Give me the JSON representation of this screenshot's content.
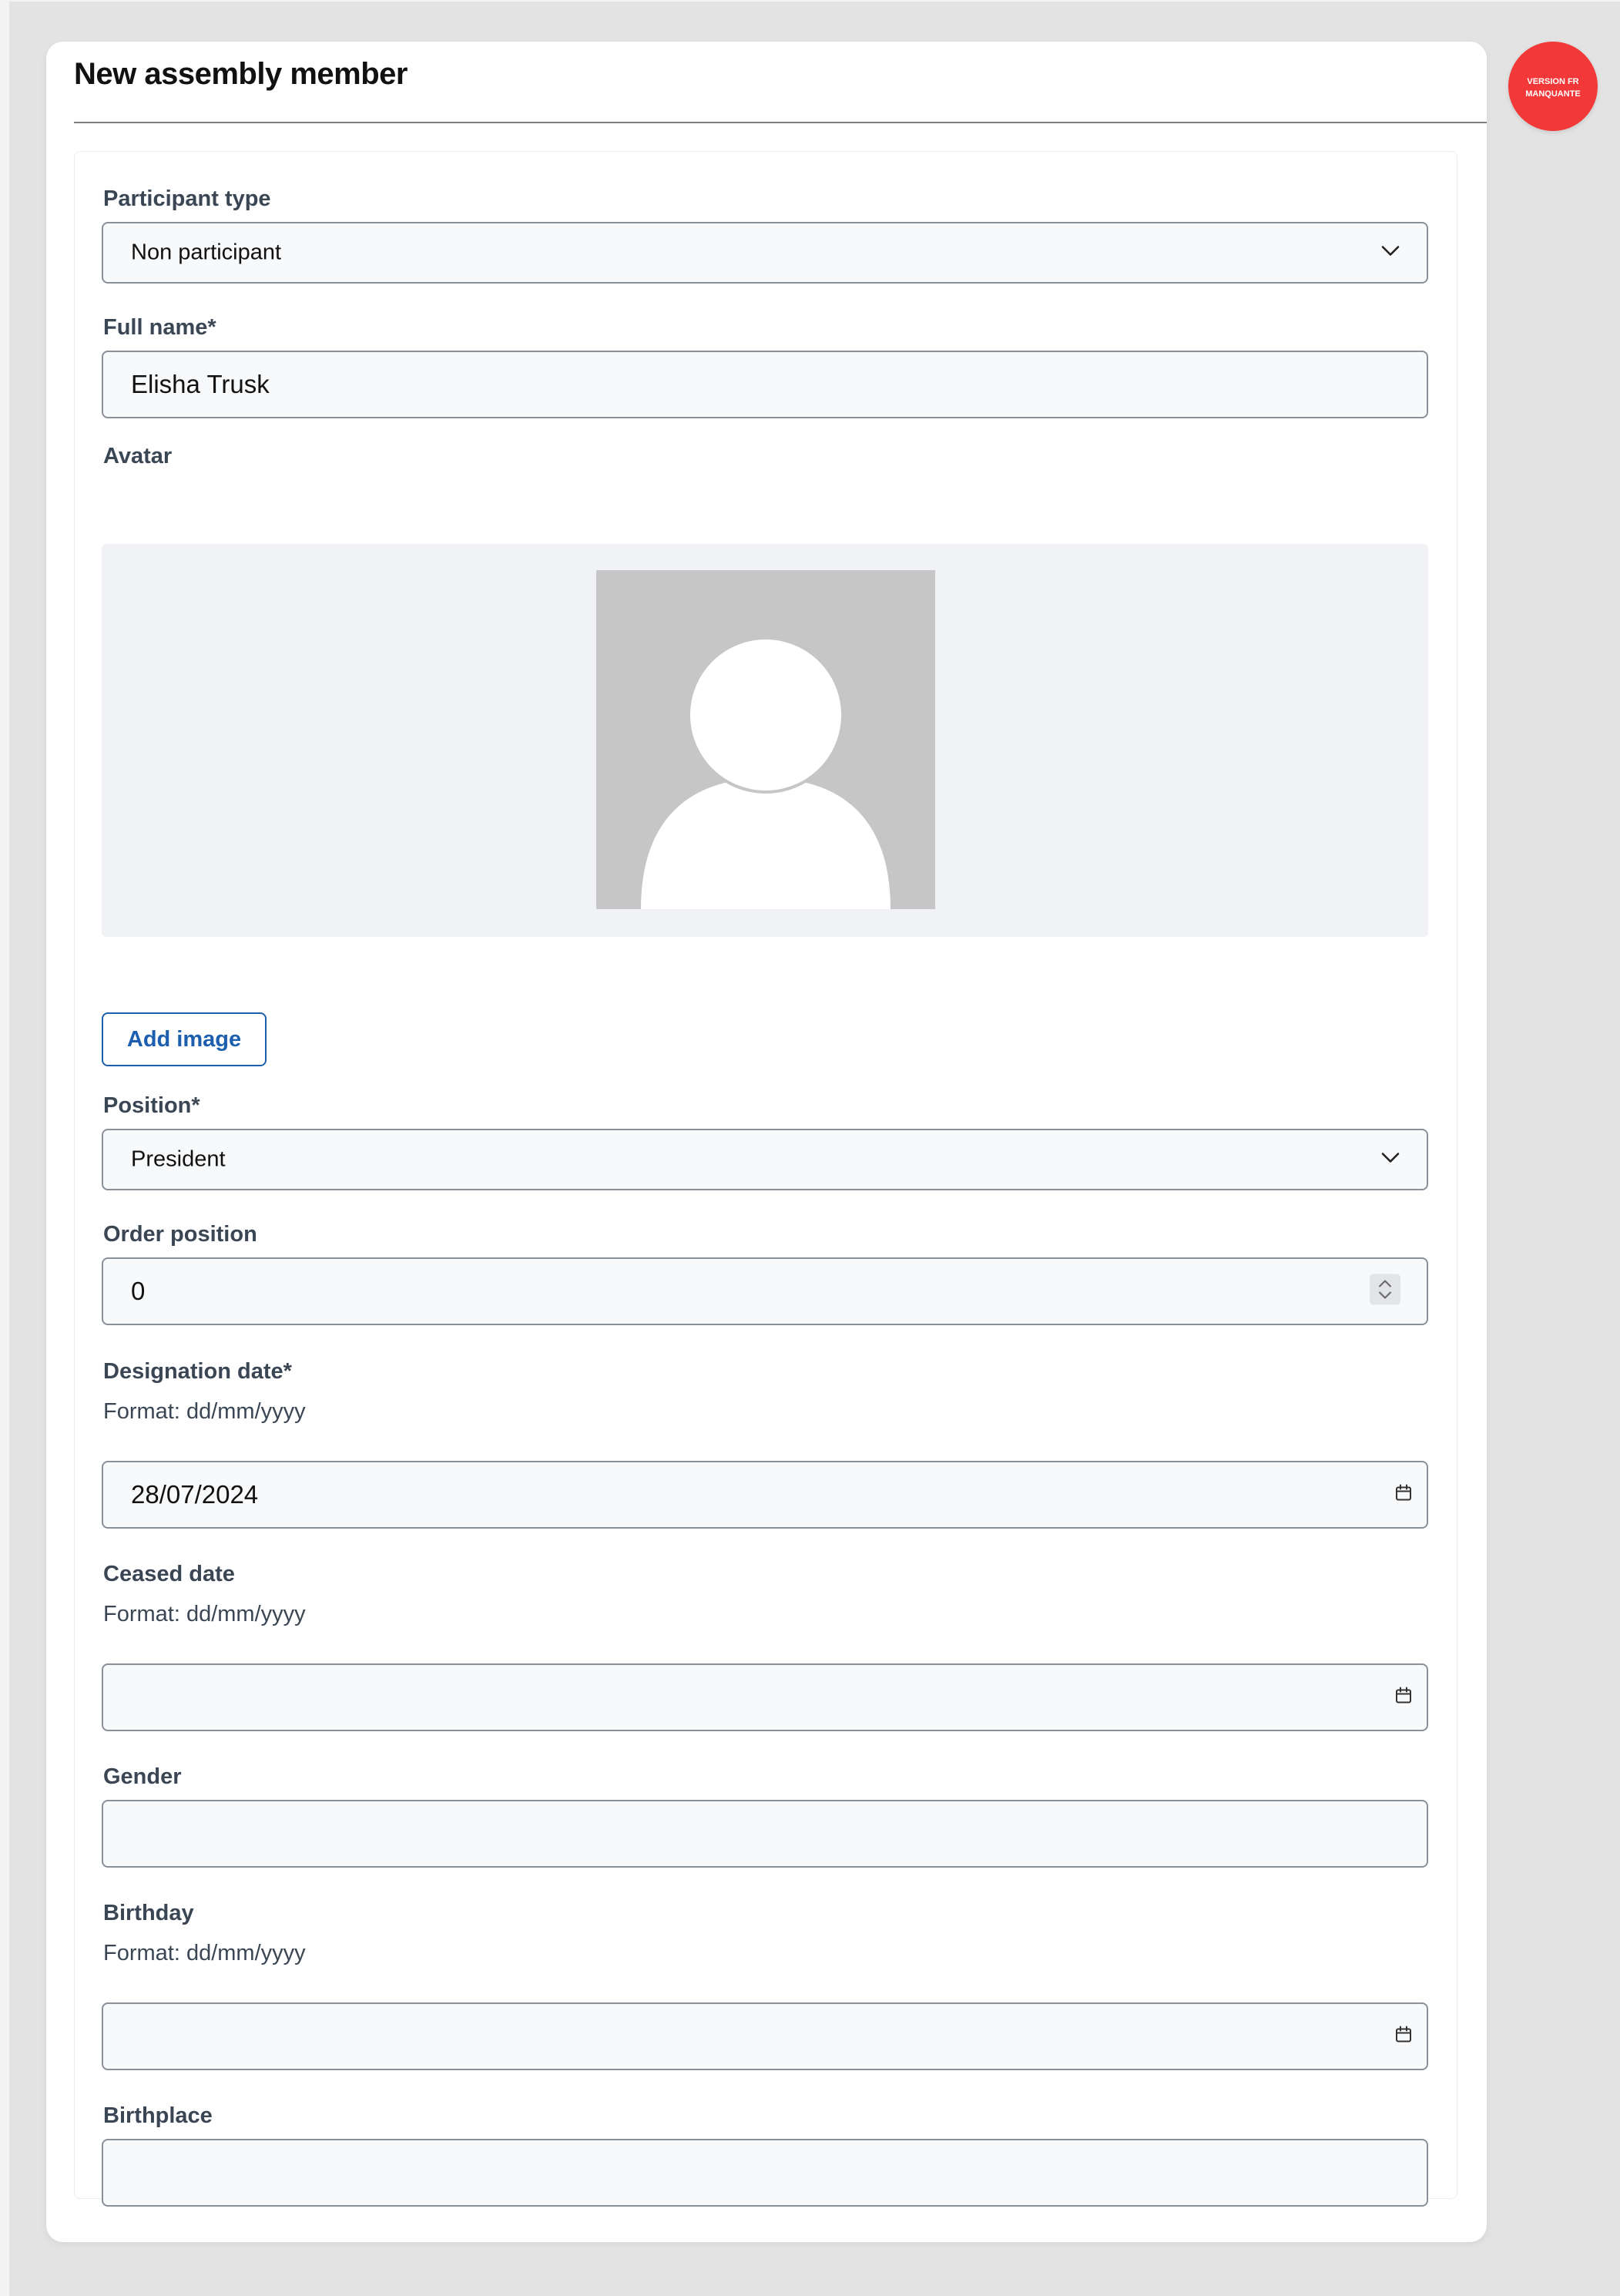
{
  "title": "New assembly member",
  "badge": {
    "text": "VERSION FR\nMANQUANTE",
    "color": "#f23838"
  },
  "accent_color": "#1d5fae",
  "form": {
    "participant_type": {
      "label": "Participant type",
      "value": "Non participant",
      "icon": "chevron-down-icon"
    },
    "full_name": {
      "label": "Full name*",
      "value": "Elisha Trusk"
    },
    "avatar": {
      "label": "Avatar",
      "placeholder_icon": "user-silhouette-icon",
      "add_image_label": "Add image"
    },
    "position": {
      "label": "Position*",
      "value": "President",
      "icon": "chevron-down-icon"
    },
    "order_position": {
      "label": "Order position",
      "value": "0",
      "icon": "stepper-icon"
    },
    "designation_date": {
      "label": "Designation date*",
      "hint": "Format: dd/mm/yyyy",
      "value": "28/07/2024",
      "icon": "calendar-icon"
    },
    "ceased_date": {
      "label": "Ceased date",
      "hint": "Format: dd/mm/yyyy",
      "value": "",
      "icon": "calendar-icon"
    },
    "gender": {
      "label": "Gender",
      "value": ""
    },
    "birthday": {
      "label": "Birthday",
      "hint": "Format: dd/mm/yyyy",
      "value": "",
      "icon": "calendar-icon"
    },
    "birthplace": {
      "label": "Birthplace",
      "value": ""
    }
  }
}
